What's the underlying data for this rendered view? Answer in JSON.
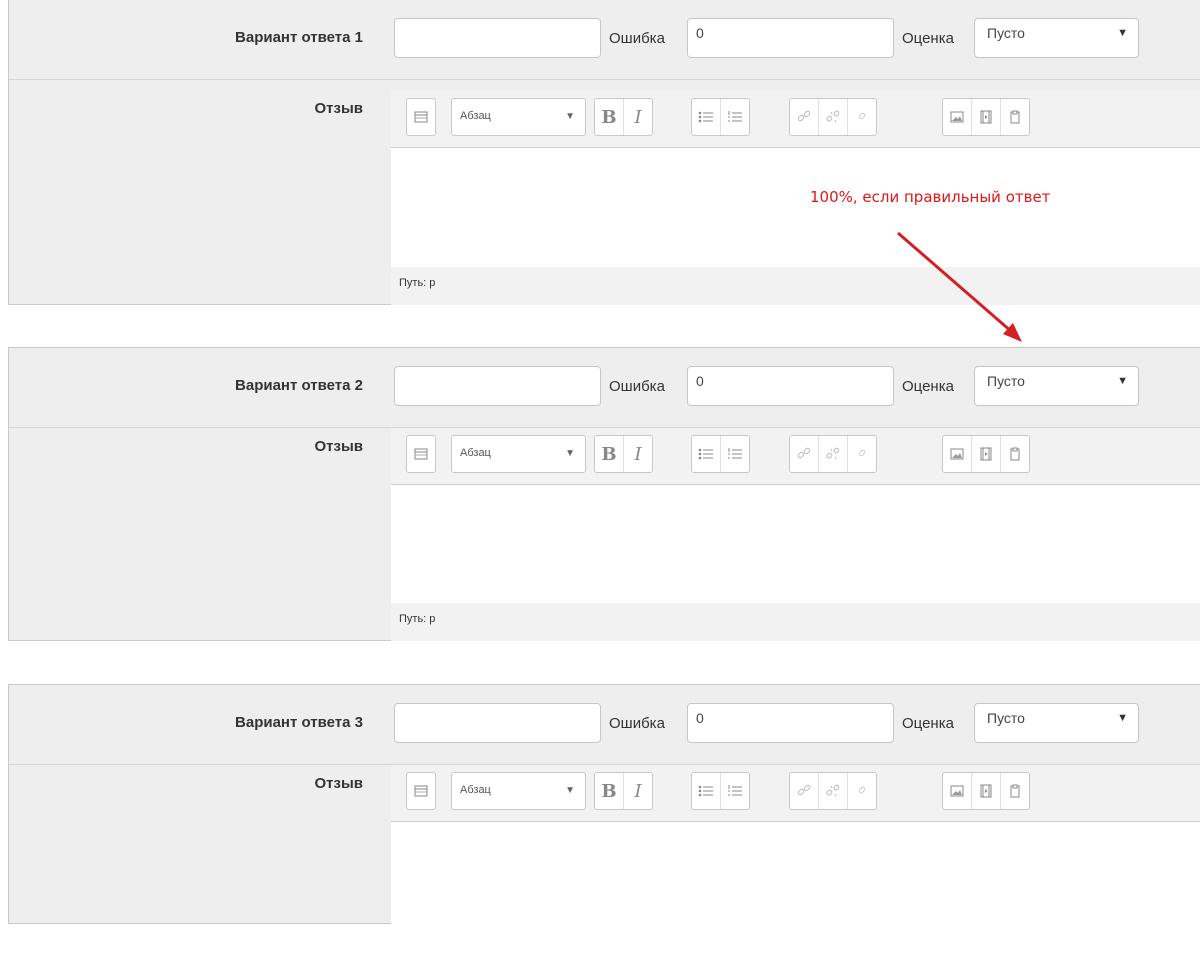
{
  "blocks": [
    {
      "answer_label": "Вариант ответа 1",
      "answer_value": "",
      "error_label": "Ошибка",
      "error_value": "0",
      "grade_label": "Оценка",
      "grade_value": "Пусто",
      "feedback_label": "Отзыв",
      "format_value": "Абзац",
      "path_label": "Путь: p"
    },
    {
      "answer_label": "Вариант ответа 2",
      "answer_value": "",
      "error_label": "Ошибка",
      "error_value": "0",
      "grade_label": "Оценка",
      "grade_value": "Пусто",
      "feedback_label": "Отзыв",
      "format_value": "Абзац",
      "path_label": "Путь: p"
    },
    {
      "answer_label": "Вариант ответа 3",
      "answer_value": "",
      "error_label": "Ошибка",
      "error_value": "0",
      "grade_label": "Оценка",
      "grade_value": "Пусто",
      "feedback_label": "Отзыв",
      "format_value": "Абзац"
    }
  ],
  "annotation": {
    "text": "100%, если правильный ответ",
    "color": "#e0161a"
  },
  "toolbar_icons": [
    "toolbar-toggle-icon",
    "bold-icon",
    "italic-icon",
    "unordered-list-icon",
    "ordered-list-icon",
    "link-icon",
    "unlink-icon",
    "anchor-icon",
    "image-icon",
    "media-icon",
    "paste-icon"
  ]
}
